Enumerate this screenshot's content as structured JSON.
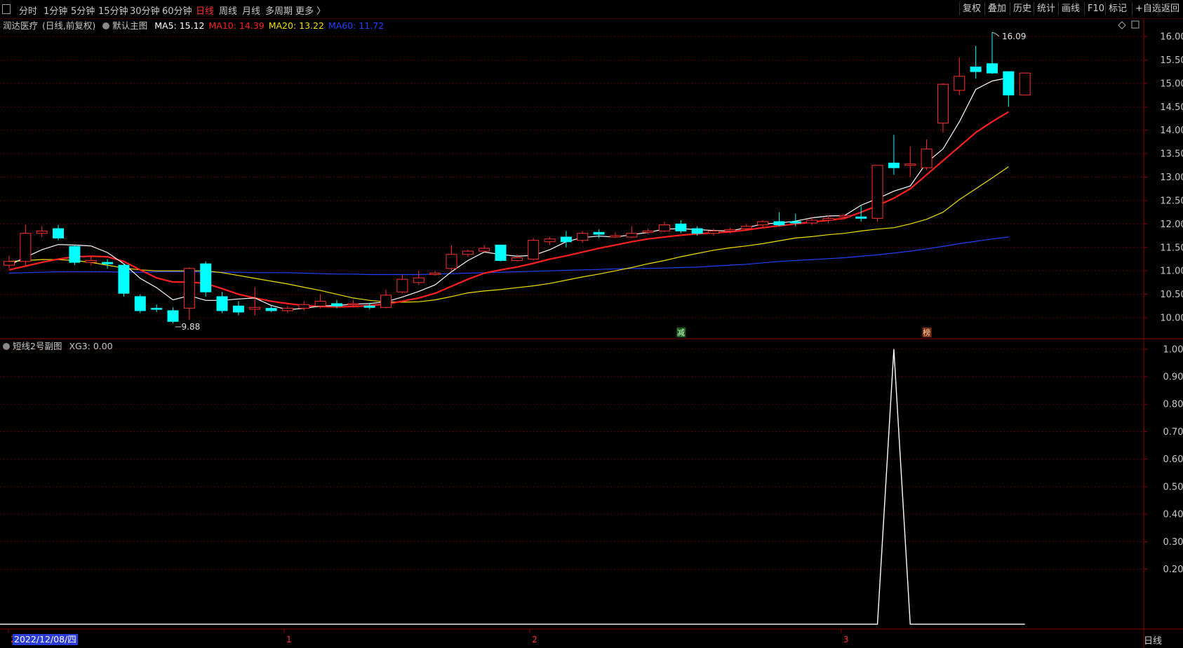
{
  "topbar": {
    "periods": [
      "分时",
      "1分钟",
      "5分钟",
      "15分钟",
      "30分钟",
      "60分钟",
      "日线",
      "周线",
      "月线",
      "多周期",
      "更多 〉"
    ],
    "active_period": "日线",
    "buttons": [
      "复权",
      "叠加",
      "历史",
      "统计",
      "画线",
      "F10",
      "标记",
      "+自选",
      "返回"
    ]
  },
  "main_legend": {
    "stock_name": "润达医疗",
    "mode": "(日线,前复权)",
    "indicator_name": "默认主图",
    "ma": [
      {
        "label": "MA5: 15.12",
        "color": "#ffffff"
      },
      {
        "label": "MA10: 14.39",
        "color": "#ff2020"
      },
      {
        "label": "MA20: 13.22",
        "color": "#f0e000"
      },
      {
        "label": "MA60: 11.72",
        "color": "#2040ff"
      }
    ]
  },
  "sub_legend": {
    "indicator_name": "短线2号副图",
    "value_label": "XG3: 0.00"
  },
  "annotations": {
    "high_label": "16.09",
    "low_label": "9.88",
    "marker_1": "减",
    "marker_2": "榜"
  },
  "x_axis": {
    "month_labels": [
      "2",
      "1",
      "2",
      "3"
    ],
    "current_date": "2022/12/08/四",
    "period_label": "日线"
  },
  "chart_data": [
    {
      "type": "candlestick",
      "title": "润达医疗 (日线,前复权)",
      "y_ticks": [
        10.0,
        10.5,
        11.0,
        11.5,
        12.0,
        12.5,
        13.0,
        13.5,
        14.0,
        14.5,
        15.0,
        15.5,
        16.0
      ],
      "ylim": [
        9.6,
        16.2
      ],
      "grid": true,
      "colors": {
        "up": "#ff3030",
        "down": "#00ffff",
        "ma5": "#ffffff",
        "ma10": "#ff2020",
        "ma20": "#f0e000",
        "ma60": "#2040ff"
      },
      "candles": [
        [
          11.12,
          11.2,
          11.32,
          11.05
        ],
        [
          11.2,
          11.8,
          11.98,
          11.1
        ],
        [
          11.8,
          11.85,
          11.95,
          11.72
        ],
        [
          11.9,
          11.7,
          11.98,
          11.65
        ],
        [
          11.52,
          11.18,
          11.55,
          11.12
        ],
        [
          11.18,
          11.22,
          11.3,
          11.12
        ],
        [
          11.18,
          11.15,
          11.25,
          11.05
        ],
        [
          11.12,
          10.52,
          11.15,
          10.45
        ],
        [
          10.45,
          10.15,
          10.5,
          10.1
        ],
        [
          10.2,
          10.18,
          10.28,
          10.12
        ],
        [
          10.15,
          9.92,
          10.22,
          9.88
        ],
        [
          10.2,
          11.05,
          11.08,
          9.95
        ],
        [
          11.15,
          10.55,
          11.2,
          10.45
        ],
        [
          10.45,
          10.15,
          10.55,
          10.1
        ],
        [
          10.25,
          10.12,
          10.35,
          10.05
        ],
        [
          10.18,
          10.22,
          10.65,
          10.05
        ],
        [
          10.2,
          10.15,
          10.25,
          10.12
        ],
        [
          10.15,
          10.2,
          10.25,
          10.1
        ],
        [
          10.2,
          10.28,
          10.35,
          10.15
        ],
        [
          10.25,
          10.35,
          10.5,
          10.2
        ],
        [
          10.3,
          10.25,
          10.38,
          10.2
        ],
        [
          10.28,
          10.3,
          10.38,
          10.22
        ],
        [
          10.25,
          10.22,
          10.32,
          10.18
        ],
        [
          10.22,
          10.48,
          10.6,
          10.2
        ],
        [
          10.55,
          10.82,
          10.92,
          10.52
        ],
        [
          10.75,
          10.85,
          11.0,
          10.7
        ],
        [
          10.92,
          10.95,
          11.0,
          10.9
        ],
        [
          11.05,
          11.35,
          11.55,
          11.0
        ],
        [
          11.35,
          11.42,
          11.45,
          11.3
        ],
        [
          11.42,
          11.48,
          11.55,
          11.38
        ],
        [
          11.55,
          11.22,
          11.55,
          11.2
        ],
        [
          11.22,
          11.28,
          11.35,
          11.2
        ],
        [
          11.25,
          11.65,
          11.7,
          11.22
        ],
        [
          11.62,
          11.68,
          11.72,
          11.55
        ],
        [
          11.72,
          11.62,
          11.85,
          11.5
        ],
        [
          11.65,
          11.8,
          11.85,
          11.6
        ],
        [
          11.82,
          11.78,
          11.88,
          11.7
        ],
        [
          11.72,
          11.75,
          11.82,
          11.7
        ],
        [
          11.72,
          11.8,
          11.95,
          11.7
        ],
        [
          11.82,
          11.85,
          11.9,
          11.78
        ],
        [
          11.85,
          11.98,
          12.05,
          11.82
        ],
        [
          12.0,
          11.85,
          12.08,
          11.8
        ],
        [
          11.9,
          11.8,
          11.95,
          11.75
        ],
        [
          11.8,
          11.85,
          11.9,
          11.75
        ],
        [
          11.85,
          11.88,
          11.92,
          11.8
        ],
        [
          11.9,
          11.95,
          12.0,
          11.85
        ],
        [
          11.98,
          12.05,
          12.08,
          11.92
        ],
        [
          12.05,
          11.98,
          12.25,
          11.95
        ],
        [
          12.05,
          12.02,
          12.22,
          11.95
        ],
        [
          12.02,
          12.08,
          12.15,
          11.98
        ],
        [
          12.08,
          12.12,
          12.18,
          12.02
        ],
        [
          12.15,
          12.18,
          12.2,
          12.1
        ],
        [
          12.15,
          12.12,
          12.38,
          12.05
        ],
        [
          12.12,
          13.25,
          13.25,
          12.05
        ],
        [
          13.3,
          13.2,
          13.9,
          13.05
        ],
        [
          13.25,
          13.28,
          13.65,
          13.0
        ],
        [
          13.2,
          13.6,
          13.8,
          13.15
        ],
        [
          14.15,
          14.98,
          15.0,
          13.95
        ],
        [
          14.85,
          15.15,
          15.55,
          14.75
        ],
        [
          15.35,
          15.25,
          15.8,
          15.1
        ],
        [
          15.42,
          15.22,
          16.09,
          15.2
        ],
        [
          15.25,
          14.75,
          15.25,
          14.5
        ],
        [
          14.75,
          15.22,
          15.22,
          14.75
        ]
      ],
      "ma5": [
        11.12,
        11.29,
        11.45,
        11.56,
        11.55,
        11.53,
        11.39,
        11.15,
        10.84,
        10.64,
        10.38,
        10.47,
        10.37,
        10.37,
        10.4,
        10.42,
        10.26,
        10.17,
        10.2,
        10.25,
        10.26,
        10.29,
        10.3,
        10.34,
        10.44,
        10.56,
        10.7,
        10.98,
        11.22,
        11.4,
        11.35,
        11.31,
        11.33,
        11.45,
        11.62,
        11.71,
        11.74,
        11.72,
        11.77,
        11.82,
        11.89,
        11.9,
        11.88,
        11.86,
        11.85,
        11.92,
        12.0,
        12.02,
        12.06,
        12.13,
        12.17,
        12.18,
        12.4,
        12.54,
        12.7,
        12.81,
        13.31,
        13.6,
        14.18,
        14.87,
        15.05,
        15.12
      ],
      "ma10": [
        11.02,
        11.1,
        11.18,
        11.25,
        11.3,
        11.31,
        11.3,
        11.2,
        11.02,
        10.85,
        10.76,
        10.76,
        10.73,
        10.62,
        10.5,
        10.42,
        10.35,
        10.3,
        10.26,
        10.24,
        10.23,
        10.24,
        10.26,
        10.29,
        10.35,
        10.42,
        10.52,
        10.67,
        10.82,
        10.95,
        11.02,
        11.08,
        11.16,
        11.25,
        11.32,
        11.4,
        11.48,
        11.55,
        11.62,
        11.68,
        11.72,
        11.76,
        11.79,
        11.81,
        11.83,
        11.87,
        11.92,
        11.96,
        12.0,
        12.04,
        12.08,
        12.12,
        12.25,
        12.39,
        12.55,
        12.75,
        13.05,
        13.35,
        13.65,
        13.95,
        14.18,
        14.39
      ],
      "ma20": [
        11.2,
        11.22,
        11.24,
        11.24,
        11.22,
        11.18,
        11.12,
        11.06,
        11.02,
        11.0,
        11.0,
        11.0,
        11.0,
        10.96,
        10.9,
        10.84,
        10.78,
        10.72,
        10.65,
        10.58,
        10.5,
        10.42,
        10.37,
        10.34,
        10.33,
        10.34,
        10.38,
        10.45,
        10.53,
        10.57,
        10.6,
        10.64,
        10.68,
        10.73,
        10.8,
        10.87,
        10.93,
        11.0,
        11.07,
        11.15,
        11.22,
        11.3,
        11.37,
        11.44,
        11.49,
        11.53,
        11.58,
        11.64,
        11.7,
        11.73,
        11.77,
        11.8,
        11.85,
        11.89,
        11.92,
        12.0,
        12.1,
        12.25,
        12.52,
        12.75,
        12.98,
        13.22
      ],
      "ma60": [
        10.95,
        10.96,
        10.97,
        10.98,
        10.98,
        10.98,
        10.98,
        10.97,
        10.97,
        10.98,
        10.98,
        10.98,
        10.97,
        10.97,
        10.97,
        10.96,
        10.96,
        10.96,
        10.95,
        10.94,
        10.93,
        10.93,
        10.92,
        10.92,
        10.92,
        10.92,
        10.93,
        10.94,
        10.95,
        10.96,
        10.97,
        10.98,
        10.99,
        11.0,
        11.01,
        11.02,
        11.03,
        11.04,
        11.05,
        11.05,
        11.06,
        11.07,
        11.08,
        11.1,
        11.12,
        11.14,
        11.17,
        11.2,
        11.22,
        11.24,
        11.26,
        11.28,
        11.31,
        11.34,
        11.38,
        11.42,
        11.47,
        11.52,
        11.58,
        11.63,
        11.68,
        11.72
      ]
    },
    {
      "type": "line",
      "title": "短线2号副图",
      "series": [
        {
          "name": "XG3",
          "color": "#ffffff",
          "values": [
            0,
            0,
            0,
            0,
            0,
            0,
            0,
            0,
            0,
            0,
            0,
            0,
            0,
            0,
            0,
            0,
            0,
            0,
            0,
            0,
            0,
            0,
            0,
            0,
            0,
            0,
            0,
            0,
            0,
            0,
            0,
            0,
            0,
            0,
            0,
            0,
            0,
            0,
            0,
            0,
            0,
            0,
            0,
            0,
            0,
            0,
            0,
            0,
            0,
            0,
            0,
            0,
            0,
            0,
            1,
            0,
            0,
            0,
            0,
            0,
            0,
            0,
            0
          ]
        }
      ],
      "y_ticks": [
        0.2,
        0.3,
        0.4,
        0.5,
        0.6,
        0.7,
        0.8,
        0.9,
        1.0
      ],
      "ylim": [
        -0.01,
        1.03
      ],
      "grid": true
    }
  ]
}
